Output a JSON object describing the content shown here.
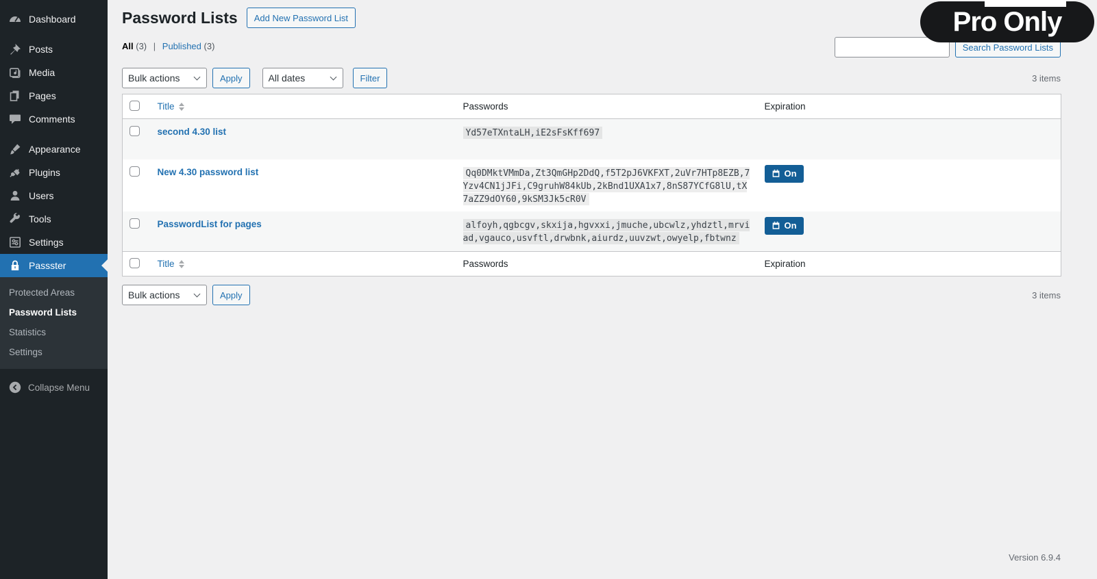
{
  "colors": {
    "accent_blue": "#2271b1",
    "sidebar_bg": "#1d2327",
    "submenu_bg": "#2c3338",
    "content_bg": "#f0f0f1",
    "pro_badge_bg": "#17181a",
    "on_badge_bg": "#135e96",
    "row_stripe": "#f6f7f7",
    "table_border": "#c3c4c7"
  },
  "sidebar": {
    "items": [
      {
        "label": "Dashboard",
        "icon": "dashboard-icon"
      },
      {
        "label": "Posts",
        "icon": "pushpin-icon"
      },
      {
        "label": "Media",
        "icon": "media-icon"
      },
      {
        "label": "Pages",
        "icon": "pages-icon"
      },
      {
        "label": "Comments",
        "icon": "comment-icon"
      },
      {
        "label": "Appearance",
        "icon": "paintbrush-icon"
      },
      {
        "label": "Plugins",
        "icon": "plug-icon"
      },
      {
        "label": "Users",
        "icon": "user-icon"
      },
      {
        "label": "Tools",
        "icon": "wrench-icon"
      },
      {
        "label": "Settings",
        "icon": "sliders-icon"
      },
      {
        "label": "Passster",
        "icon": "lock-icon"
      }
    ],
    "submenu": [
      {
        "label": "Protected Areas"
      },
      {
        "label": "Password Lists"
      },
      {
        "label": "Statistics"
      },
      {
        "label": "Settings"
      }
    ],
    "collapse_label": "Collapse Menu"
  },
  "pro_badge": {
    "label": "Pro Only"
  },
  "page": {
    "title": "Password Lists",
    "add_new_label": "Add New Password List",
    "version": "Version 6.9.4"
  },
  "filters": {
    "all_label": "All",
    "all_count": "(3)",
    "separator": "|",
    "published_label": "Published",
    "published_count": "(3)"
  },
  "search": {
    "button_label": "Search Password Lists"
  },
  "toolbar_top": {
    "bulk_actions": "Bulk actions",
    "apply": "Apply",
    "dates": "All dates",
    "filter": "Filter",
    "items_count": "3 items"
  },
  "toolbar_bottom": {
    "bulk_actions": "Bulk actions",
    "apply": "Apply",
    "items_count": "3 items"
  },
  "table": {
    "columns": {
      "title": "Title",
      "passwords": "Passwords",
      "expiration": "Expiration"
    },
    "rows": [
      {
        "title": "second 4.30 list",
        "passwords": "Yd57eTXntaLH,iE2sFsKff697",
        "expiration_label": ""
      },
      {
        "title": "New 4.30 password list",
        "passwords": "Qq0DMktVMmDa,Zt3QmGHp2DdQ,f5T2pJ6VKFXT,2uVr7HTp8EZB,7Yzv4CN1jJFi,C9gruhW84kUb,2kBnd1UXA1x7,8nS87YCfG8lU,tX7aZZ9dOY60,9kSM3Jk5cR0V",
        "expiration_label": "On"
      },
      {
        "title": "PasswordList for pages",
        "passwords": "alfoyh,qgbcgv,skxija,hgvxxi,jmuche,ubcwlz,yhdztl,mrviad,vgauco,usvftl,drwbnk,aiurdz,uuvzwt,owyelp,fbtwnz",
        "expiration_label": "On"
      }
    ]
  }
}
